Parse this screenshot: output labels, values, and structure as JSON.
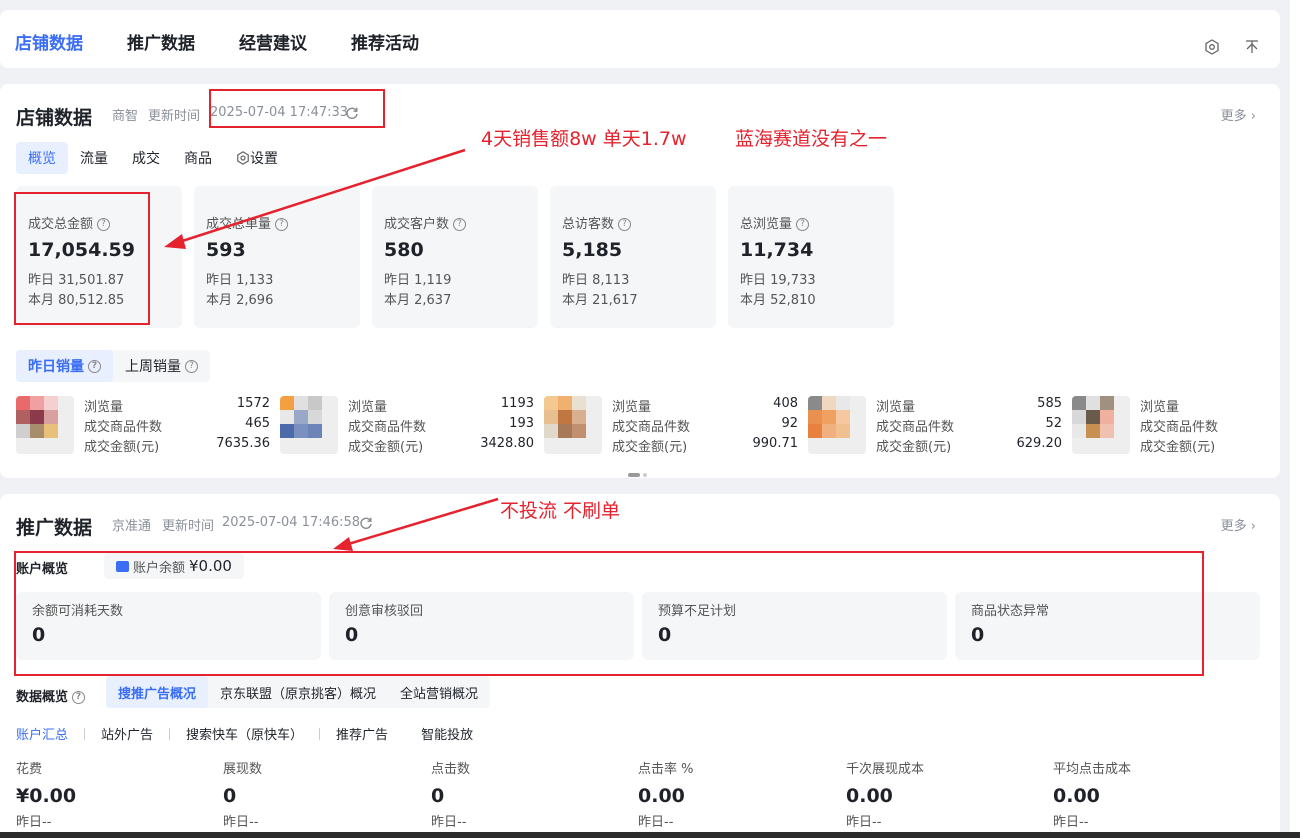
{
  "topnav": {
    "tabs": [
      {
        "label": "店铺数据",
        "active": true
      },
      {
        "label": "推广数据",
        "active": false
      },
      {
        "label": "经营建议",
        "active": false
      },
      {
        "label": "推荐活动",
        "active": false
      }
    ],
    "icons": [
      "settings-hex-icon",
      "pin-top-icon"
    ]
  },
  "store": {
    "title": "店铺数据",
    "source": "商智",
    "update_label": "更新时间",
    "update_time": "2025-07-04 17:47:33",
    "more": "更多",
    "tabs": [
      {
        "label": "概览",
        "active": true
      },
      {
        "label": "流量",
        "active": false
      },
      {
        "label": "成交",
        "active": false
      },
      {
        "label": "商品",
        "active": false
      }
    ],
    "settings_label": "设置",
    "metrics": [
      {
        "label": "成交总金额",
        "value": "17,054.59",
        "yesterday": "昨日 31,501.87",
        "month": "本月 80,512.85"
      },
      {
        "label": "成交总单量",
        "value": "593",
        "yesterday": "昨日 1,133",
        "month": "本月 2,696"
      },
      {
        "label": "成交客户数",
        "value": "580",
        "yesterday": "昨日 1,119",
        "month": "本月 2,637"
      },
      {
        "label": "总访客数",
        "value": "5,185",
        "yesterday": "昨日 8,113",
        "month": "本月 21,617"
      },
      {
        "label": "总浏览量",
        "value": "11,734",
        "yesterday": "昨日 19,733",
        "month": "本月 52,810"
      }
    ],
    "sales_tabs": [
      {
        "label": "昨日销量",
        "active": true
      },
      {
        "label": "上周销量",
        "active": false
      }
    ],
    "product_row_labels": [
      "浏览量",
      "成交商品件数",
      "成交金额(元)"
    ],
    "products": [
      {
        "views": "1572",
        "items": "465",
        "amount": "7635.36"
      },
      {
        "views": "1193",
        "items": "193",
        "amount": "3428.80"
      },
      {
        "views": "408",
        "items": "92",
        "amount": "990.71"
      },
      {
        "views": "585",
        "items": "52",
        "amount": "629.20"
      },
      {
        "views": "",
        "items": "",
        "amount": ""
      }
    ]
  },
  "promo": {
    "title": "推广数据",
    "source": "京准通",
    "update_label": "更新时间",
    "update_time": "2025-07-04 17:46:58",
    "more": "更多",
    "account_overview": "账户概览",
    "balance_label": "账户余额",
    "balance_value": "¥0.00",
    "account_stats": [
      {
        "label": "余额可消耗天数",
        "value": "0"
      },
      {
        "label": "创意审核驳回",
        "value": "0"
      },
      {
        "label": "预算不足计划",
        "value": "0"
      },
      {
        "label": "商品状态异常",
        "value": "0"
      }
    ],
    "data_overview": "数据概览",
    "data_tabs": [
      {
        "label": "搜推广告概况",
        "active": true
      },
      {
        "label": "京东联盟（原京挑客）概况",
        "active": false
      },
      {
        "label": "全站营销概况",
        "active": false
      }
    ],
    "filter_tabs": [
      {
        "label": "账户汇总",
        "active": true
      },
      {
        "label": "站外广告",
        "active": false
      },
      {
        "label": "搜索快车（原快车）",
        "active": false
      },
      {
        "label": "推荐广告",
        "active": false
      },
      {
        "label": "智能投放",
        "active": false
      }
    ],
    "kpis": [
      {
        "label": "花费",
        "value": "¥0.00",
        "sub": "昨日--"
      },
      {
        "label": "展现数",
        "value": "0",
        "sub": "昨日--"
      },
      {
        "label": "点击数",
        "value": "0",
        "sub": "昨日--"
      },
      {
        "label": "点击率 %",
        "value": "0.00",
        "sub": "昨日--"
      },
      {
        "label": "千次展现成本",
        "value": "0.00",
        "sub": "昨日--"
      },
      {
        "label": "平均点击成本",
        "value": "0.00",
        "sub": "昨日--"
      }
    ]
  },
  "annotations": {
    "sales_note": "4天销售额8w 单天1.7w",
    "market_note": "蓝海赛道没有之一",
    "promo_note": "不投流  不刷单",
    "color": "#e5232f"
  },
  "colors": {
    "accent": "#3b6ef5",
    "annotation": "#e5232f"
  }
}
